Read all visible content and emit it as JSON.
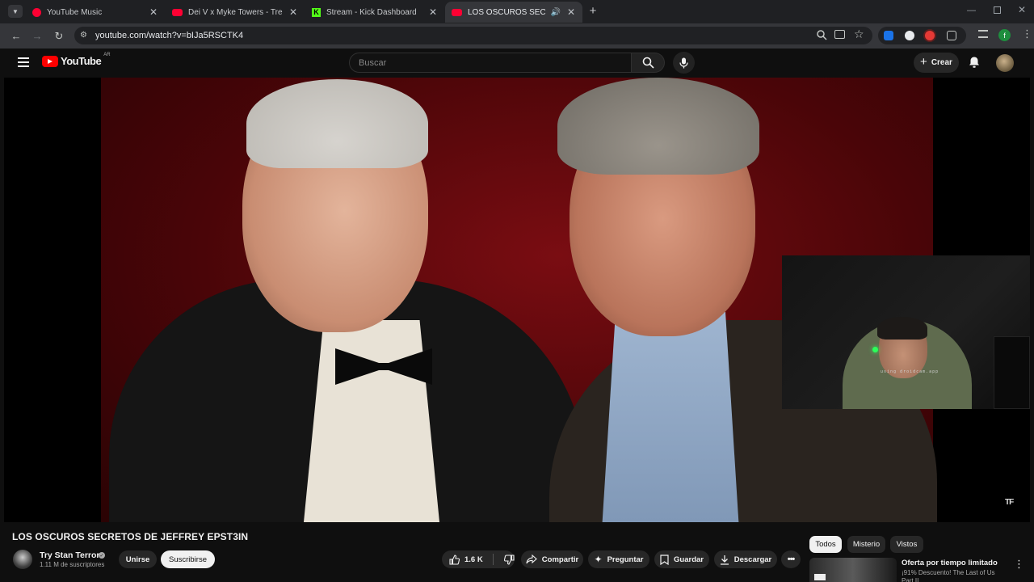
{
  "browser": {
    "tabs": [
      {
        "title": "YouTube Music",
        "favicon_color": "#ff0033",
        "active": false
      },
      {
        "title": "Dei V x Myke Towers - Trending",
        "favicon_color": "#ff0033",
        "active": false
      },
      {
        "title": "Stream - Kick Dashboard",
        "favicon_color": "#53fc18",
        "favicon_letter": "K",
        "active": false
      },
      {
        "title": "LOS OSCUROS SECRETOS D",
        "favicon_color": "#ff0033",
        "active": true
      }
    ],
    "new_tab_label": "+",
    "url": "youtube.com/watch?v=bIJa5RSCTK4",
    "profile_initial": "f"
  },
  "youtube": {
    "logo_text": "YouTube",
    "logo_region": "AR",
    "search_placeholder": "Buscar",
    "create_label": "Crear"
  },
  "video": {
    "title": "LOS OSCUROS SECRETOS DE JEFFREY EPST3IN",
    "overlay_badge": "TF",
    "webcam_caption": "using droidcam.app"
  },
  "channel": {
    "name": "Try Stan Terror",
    "subscribers": "1.11 M de suscriptores",
    "join_label": "Unirse",
    "subscribe_label": "Suscribirse"
  },
  "actions": {
    "likes": "1.6 K",
    "share": "Compartir",
    "ask": "Preguntar",
    "save": "Guardar",
    "download": "Descargar"
  },
  "sidebar": {
    "chips": [
      {
        "label": "Todos",
        "selected": true
      },
      {
        "label": "Misterio",
        "selected": false
      },
      {
        "label": "Vistos",
        "selected": false
      }
    ],
    "ad_title": "Oferta por tiempo limitado",
    "ad_subtitle": "¡91% Descuento! The Last of Us Part II"
  }
}
